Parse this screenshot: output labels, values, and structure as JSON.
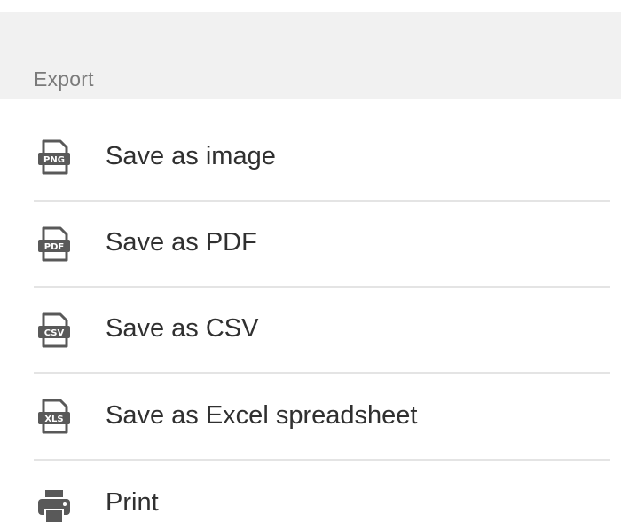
{
  "menu": {
    "title": "Export",
    "items": [
      {
        "label": "Save as image",
        "icon": "png-file-icon",
        "icon_text": "PNG"
      },
      {
        "label": "Save as PDF",
        "icon": "pdf-file-icon",
        "icon_text": "PDF"
      },
      {
        "label": "Save as CSV",
        "icon": "csv-file-icon",
        "icon_text": "CSV"
      },
      {
        "label": "Save as Excel spreadsheet",
        "icon": "xls-file-icon",
        "icon_text": "XLS"
      },
      {
        "label": "Print",
        "icon": "printer-icon"
      }
    ]
  },
  "colors": {
    "header_bg": "#f1f1f1",
    "header_text": "#7a7a7a",
    "item_text": "#303030",
    "icon": "#595959",
    "divider": "#e4e4e4"
  }
}
